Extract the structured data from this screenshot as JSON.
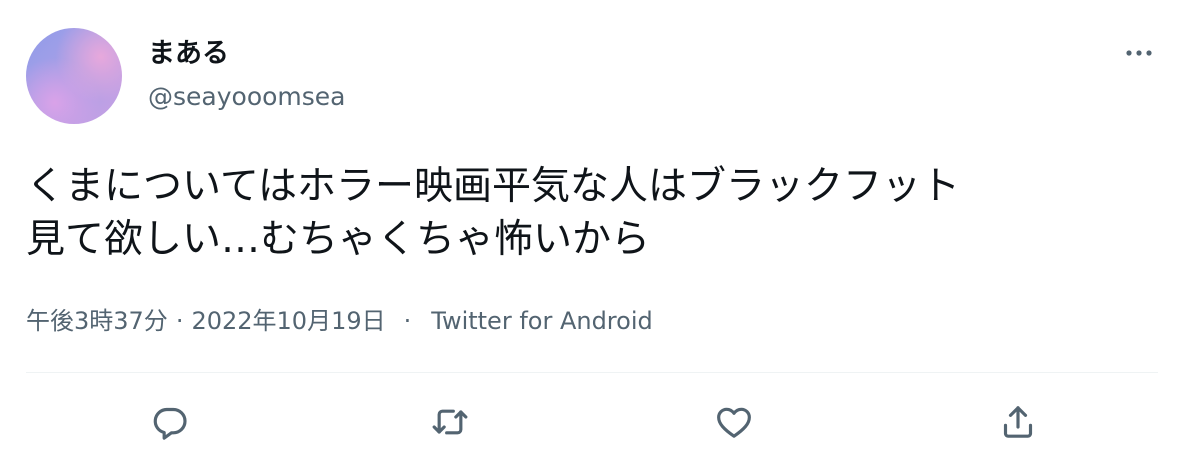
{
  "user": {
    "display_name": "まある",
    "handle": "@seayooomsea"
  },
  "tweet": {
    "text": "くまについてはホラー映画平気な人はブラックフット\n見て欲しい…むちゃくちゃ怖いから",
    "time": "午後3時37分",
    "dot": "·",
    "date": "2022年10月19日",
    "separator": "·",
    "source": "Twitter for Android"
  },
  "icons": {
    "more": "more-horizontal-icon",
    "reply": "reply-icon",
    "retweet": "retweet-icon",
    "like": "heart-icon",
    "share": "share-icon"
  },
  "colors": {
    "text": "#0f1419",
    "secondary": "#536471",
    "divider": "#eff3f4"
  }
}
